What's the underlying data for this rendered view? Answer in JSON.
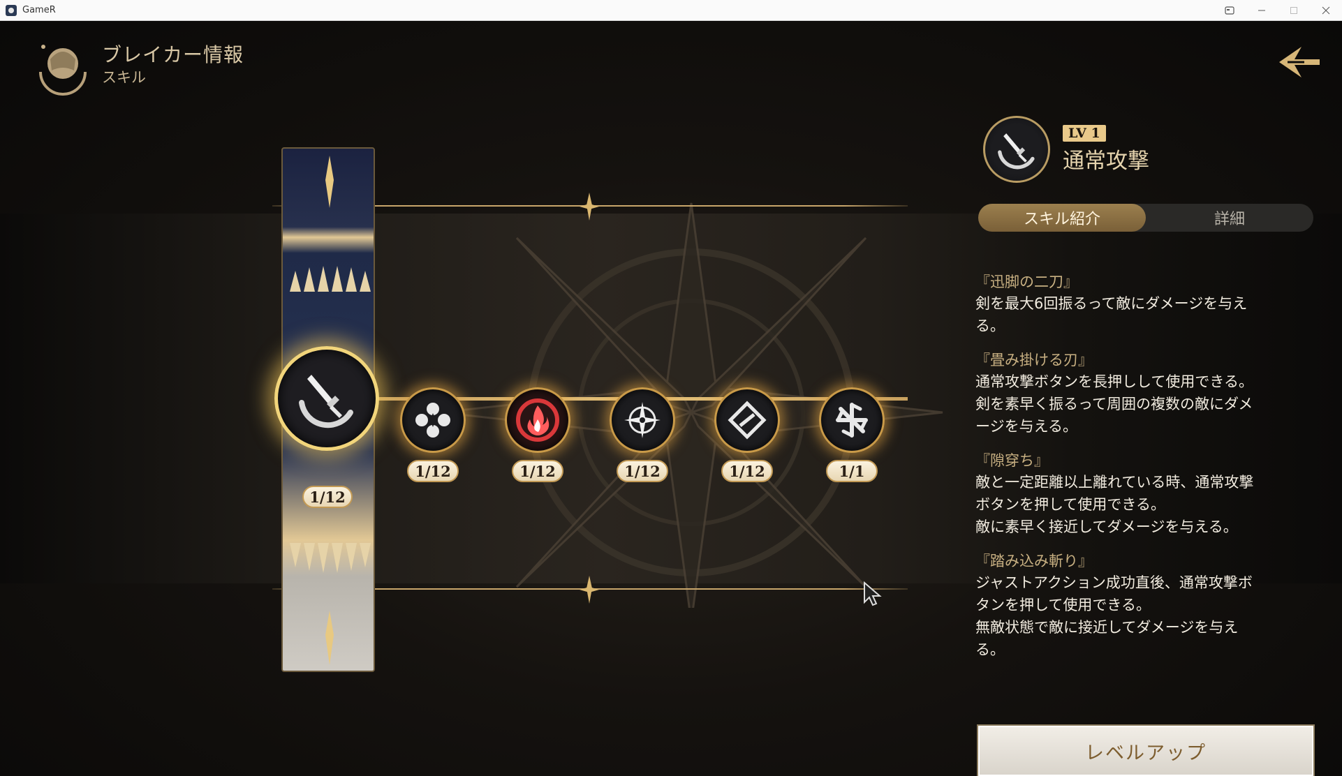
{
  "window": {
    "title": "GameR"
  },
  "header": {
    "title": "ブレイカー情報",
    "subtitle": "スキル"
  },
  "skill_tree": {
    "nodes": [
      {
        "icon": "sword-icon",
        "progress": "1/12"
      },
      {
        "icon": "star-flower-icon",
        "progress": "1/12"
      },
      {
        "icon": "flame-icon",
        "progress": "1/12"
      },
      {
        "icon": "compass-icon",
        "progress": "1/12"
      },
      {
        "icon": "diamond-slash-icon",
        "progress": "1/12"
      },
      {
        "icon": "swirl-icon",
        "progress": "1/1"
      }
    ]
  },
  "panel": {
    "level": "LV 1",
    "skill_name": "通常攻撃",
    "tabs": {
      "intro": "スキル紹介",
      "details": "詳細"
    },
    "sections": [
      {
        "title": "『迅脚の二刀』",
        "body": [
          "剣を最大6回振るって敵にダメージを与え",
          "る。"
        ]
      },
      {
        "title": "『畳み掛ける刃』",
        "body": [
          "通常攻撃ボタンを長押しして使用できる。",
          "剣を素早く振るって周囲の複数の敵にダメ",
          "ージを与える。"
        ]
      },
      {
        "title": "『隙穿ち』",
        "body": [
          "敵と一定距離以上離れている時、通常攻撃",
          "ボタンを押して使用できる。",
          "敵に素早く接近してダメージを与える。"
        ]
      },
      {
        "title": "『踏み込み斬り』",
        "body": [
          "ジャストアクション成功直後、通常攻撃ボ",
          "タンを押して使用できる。",
          "無敵状態で敵に接近してダメージを与え",
          "る。"
        ]
      }
    ],
    "level_up_label": "レベルアップ"
  },
  "colors": {
    "accent_gold": "#c9a66b",
    "text_light": "#f2ece0",
    "fire_red": "#d9383a"
  }
}
